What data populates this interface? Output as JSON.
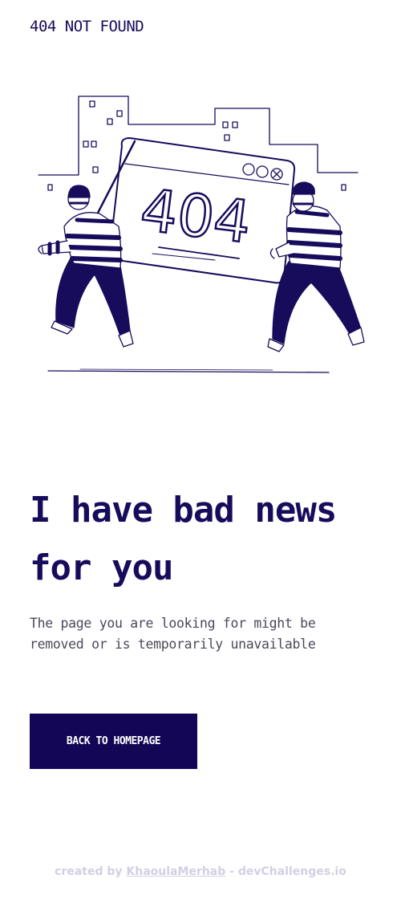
{
  "header": {
    "logo_text": "404 NOT FOUND"
  },
  "illustration": {
    "screen_text": "404",
    "icon": "thieves-carrying-404-screen-illustration"
  },
  "main": {
    "headline": "I have bad news for you",
    "description": "The page you are looking for might be removed or is temporarily unavailable",
    "cta_label": "BACK TO HOMEPAGE"
  },
  "footer": {
    "prefix": "created by ",
    "author": "KhaoulaMerhab",
    "suffix": " - devChallenges.io"
  },
  "colors": {
    "primary": "#170c5c",
    "button_bg": "#140656",
    "body_text": "#4a4a5a",
    "footer_text": "#d0d0e4"
  }
}
